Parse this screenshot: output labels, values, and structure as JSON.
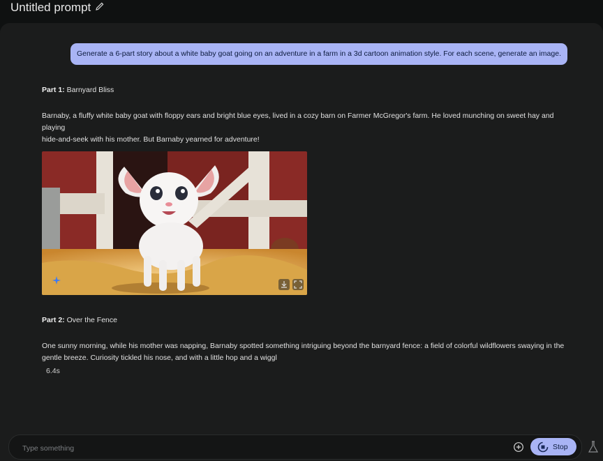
{
  "header": {
    "title": "Untitled prompt"
  },
  "user_message": "Generate a 6-part story about a white baby goat going on an adventure in a farm in a 3d cartoon animation style. For each scene, generate an image.",
  "response": {
    "part1": {
      "label": "Part 1:",
      "title": "Barnyard Bliss",
      "line1": "Barnaby, a fluffy white baby goat with floppy ears and bright blue eyes, lived in a cozy barn on Farmer McGregor's farm. He loved munching on sweet hay and playing",
      "line2": "hide-and-seek with his mother. But Barnaby yearned for adventure!"
    },
    "part2": {
      "label": "Part 2:",
      "title": "Over the Fence",
      "line1": "One sunny morning, while his mother was napping, Barnaby spotted something intriguing beyond the barnyard fence: a field of colorful wildflowers swaying in the",
      "line2": "gentle breeze. Curiosity tickled his nose, and with a little hop and a wiggl"
    },
    "timing": "6.4s"
  },
  "composer": {
    "placeholder": "Type something",
    "stop_label": "Stop"
  },
  "colors": {
    "accent": "#a9b4f5",
    "panel": "#1b1c1c",
    "barn_red": "#8a2a26"
  }
}
